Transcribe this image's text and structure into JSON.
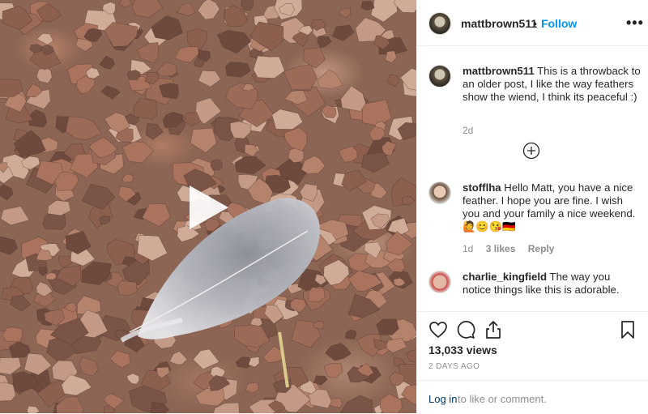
{
  "header": {
    "username": "mattbrown511",
    "separator": "•",
    "follow_label": "Follow",
    "more_label": "•••"
  },
  "caption": {
    "username": "mattbrown511",
    "text": "This is a throwback to an older post, I like the way feathers show the wiend, I think its peaceful :)",
    "age": "2d"
  },
  "comments": [
    {
      "username": "stofflha",
      "text": "Hello Matt, you have a nice feather. I hope you are fine. I wish you and your family a nice weekend. 🙋😊😘🇩🇪",
      "age": "1d",
      "likes": "3 likes",
      "reply_label": "Reply"
    },
    {
      "username": "charlie_kingfield",
      "text": "The way you notice things like this is adorable."
    }
  ],
  "stats": {
    "views": "13,033 views",
    "date": "2 DAYS AGO"
  },
  "login": {
    "link_label": "Log in",
    "rest_text": "to like or comment."
  },
  "icons": {
    "play": "play-icon",
    "like": "heart-icon",
    "comment": "comment-icon",
    "share": "share-icon",
    "save": "bookmark-icon",
    "load_more": "plus-circle-icon"
  },
  "colors": {
    "follow": "#0095f6",
    "link": "#00376b",
    "muted": "#8e8e8e"
  }
}
